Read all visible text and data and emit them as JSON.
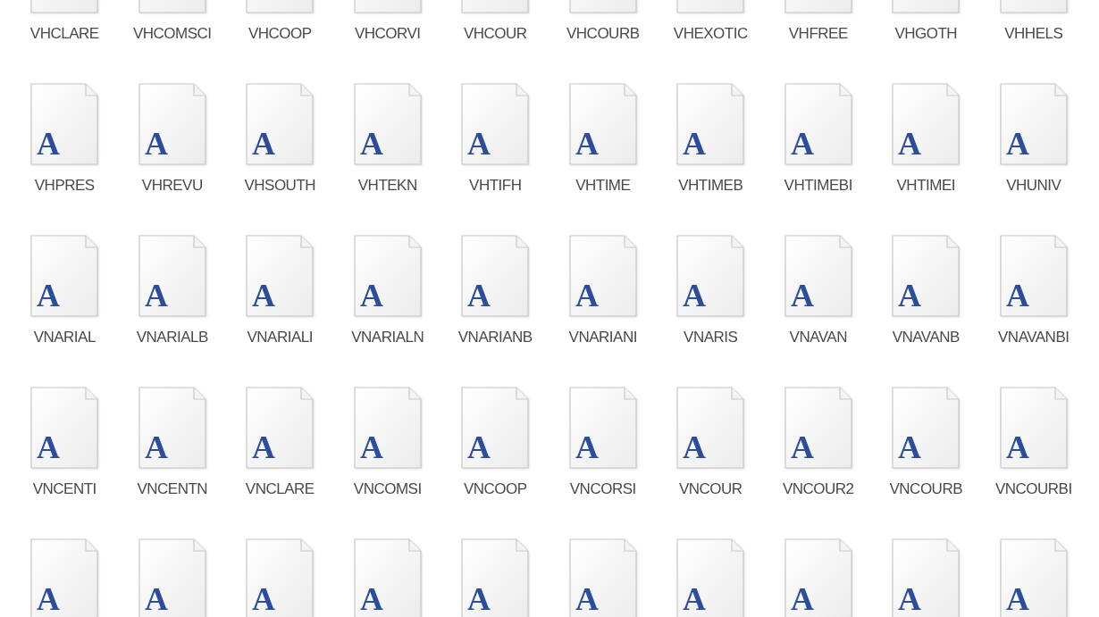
{
  "files": [
    {
      "name": "VHCLARE"
    },
    {
      "name": "VHCOMSCI"
    },
    {
      "name": "VHCOOP"
    },
    {
      "name": "VHCORVI"
    },
    {
      "name": "VHCOUR"
    },
    {
      "name": "VHCOURB"
    },
    {
      "name": "VHEXOTIC"
    },
    {
      "name": "VHFREE"
    },
    {
      "name": "VHGOTH"
    },
    {
      "name": "VHHELS"
    },
    {
      "name": "VHPRES",
      "glyph": "A"
    },
    {
      "name": "VHREVU",
      "glyph": "A"
    },
    {
      "name": "VHSOUTH",
      "glyph": "A"
    },
    {
      "name": "VHTEKN",
      "glyph": "A"
    },
    {
      "name": "VHTIFH",
      "glyph": "A"
    },
    {
      "name": "VHTIME",
      "glyph": "A"
    },
    {
      "name": "VHTIMEB",
      "glyph": "A"
    },
    {
      "name": "VHTIMEBI",
      "glyph": "A"
    },
    {
      "name": "VHTIMEI",
      "glyph": "A"
    },
    {
      "name": "VHUNIV",
      "glyph": "A"
    },
    {
      "name": "VNARIAL",
      "glyph": "A"
    },
    {
      "name": "VNARIALB",
      "glyph": "A"
    },
    {
      "name": "VNARIALI",
      "glyph": "A"
    },
    {
      "name": "VNARIALN",
      "glyph": "A"
    },
    {
      "name": "VNARIANB",
      "glyph": "A"
    },
    {
      "name": "VNARIANI",
      "glyph": "A"
    },
    {
      "name": "VNARIS",
      "glyph": "A"
    },
    {
      "name": "VNAVAN",
      "glyph": "A"
    },
    {
      "name": "VNAVANB",
      "glyph": "A"
    },
    {
      "name": "VNAVANBI",
      "glyph": "A"
    },
    {
      "name": "VNCENTI",
      "glyph": "A"
    },
    {
      "name": "VNCENTN",
      "glyph": "A"
    },
    {
      "name": "VNCLARE",
      "glyph": "A"
    },
    {
      "name": "VNCOMSI",
      "glyph": "A"
    },
    {
      "name": "VNCOOP",
      "glyph": "A"
    },
    {
      "name": "VNCORSI",
      "glyph": "A"
    },
    {
      "name": "VNCOUR",
      "glyph": "A"
    },
    {
      "name": "VNCOUR2",
      "glyph": "A"
    },
    {
      "name": "VNCOURB",
      "glyph": "A"
    },
    {
      "name": "VNCOURBI",
      "glyph": "A"
    },
    {
      "glyph": "A"
    },
    {
      "glyph": "A"
    },
    {
      "glyph": "A"
    },
    {
      "glyph": "A"
    },
    {
      "glyph": "A"
    },
    {
      "glyph": "A"
    },
    {
      "glyph": "A"
    },
    {
      "glyph": "A"
    },
    {
      "glyph": "A"
    },
    {
      "glyph": "A"
    }
  ]
}
